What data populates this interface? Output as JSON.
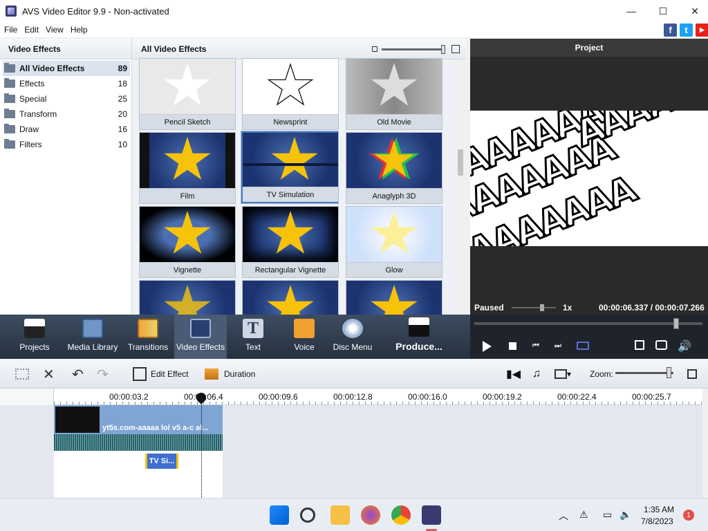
{
  "window": {
    "title": "AVS Video Editor 9.9 - Non-activated",
    "minimize": "—",
    "maximize": "☐",
    "close": "✕"
  },
  "menu": [
    "File",
    "Edit",
    "View",
    "Help"
  ],
  "social": [
    {
      "label": "f",
      "color": "#3b5998"
    },
    {
      "label": "t",
      "color": "#1da1f2"
    },
    {
      "label": "▶",
      "color": "#e62117"
    }
  ],
  "left_panel": {
    "title": "Video Effects",
    "items": [
      {
        "label": "All Video Effects",
        "count": "89"
      },
      {
        "label": "Effects",
        "count": "18"
      },
      {
        "label": "Special",
        "count": "25"
      },
      {
        "label": "Transform",
        "count": "20"
      },
      {
        "label": "Draw",
        "count": "16"
      },
      {
        "label": "Filters",
        "count": "10"
      }
    ]
  },
  "gallery": {
    "title": "All Video Effects",
    "effects": [
      "Pencil Sketch",
      "Newsprint",
      "Old Movie",
      "Film",
      "TV Simulation",
      "Anaglyph 3D",
      "Vignette",
      "Rectangular Vignette",
      "Glow"
    ]
  },
  "preview": {
    "title": "Project",
    "status": "Paused",
    "speed": "1x",
    "time": "00:00:06.337 / 00:00:07.266"
  },
  "toolbar": [
    "Projects",
    "Media Library",
    "Transitions",
    "Video Effects",
    "Text",
    "Voice",
    "Disc Menu",
    "Produce..."
  ],
  "timeline": {
    "edit_effect": "Edit Effect",
    "duration": "Duration",
    "zoom": "Zoom:",
    "ticks": [
      "00:00:03.2",
      "00:00:06.4",
      "00:00:09.6",
      "00:00:12.8",
      "00:00:16.0",
      "00:00:19.2",
      "00:00:22.4",
      "00:00:25.7"
    ],
    "clip_label": "yt5s.com-aaaaa lol v5 a-c al...",
    "effect_clip": "TV Si..."
  },
  "taskbar": {
    "time": "1:35 AM",
    "date": "7/8/2023",
    "notif": "1"
  },
  "colors": {
    "accent": "#4a78b8",
    "toolbar_bg": "#2e3a4b",
    "star": "#f6c30a"
  }
}
